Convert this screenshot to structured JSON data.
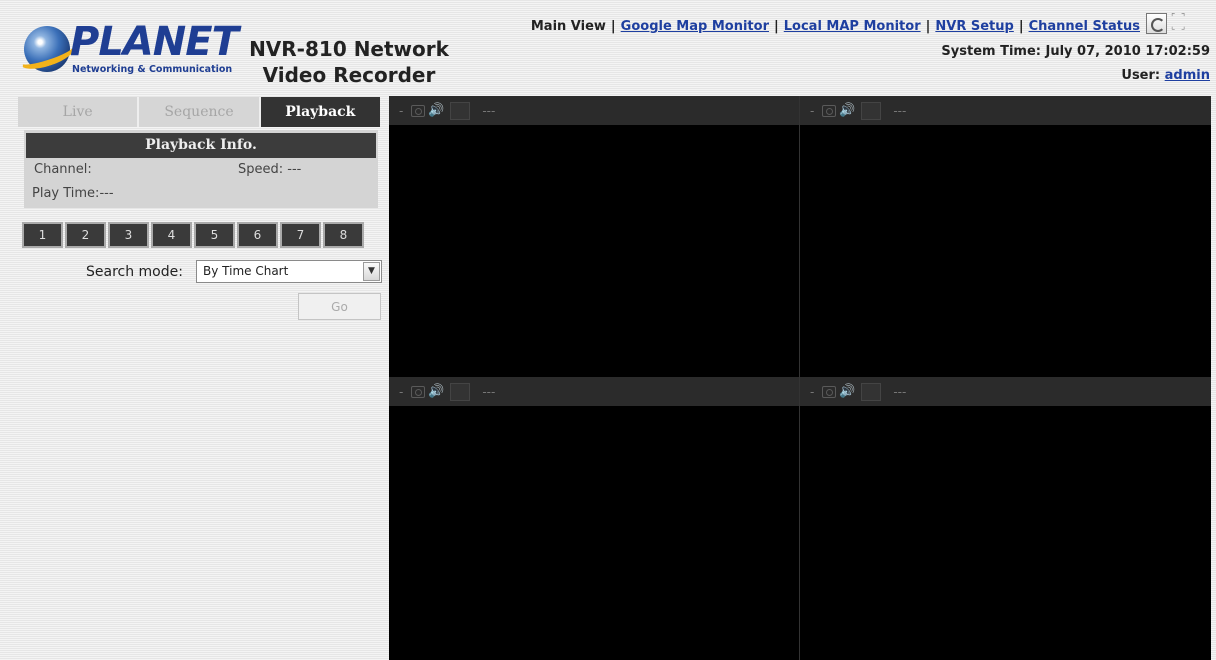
{
  "logo": {
    "text": "PLANET",
    "tagline": "Networking & Communication"
  },
  "product": {
    "line1": "NVR-810 Network",
    "line2": "Video Recorder"
  },
  "nav": {
    "main_view": "Main View",
    "google_map": "Google Map Monitor",
    "local_map": "Local MAP Monitor",
    "nvr_setup": "NVR Setup",
    "channel_status": "Channel Status",
    "separator": "|"
  },
  "system_time": "System Time: July 07, 2010 17:02:59",
  "user": {
    "label": "User:",
    "name": "admin"
  },
  "tabs": [
    {
      "label": "Live"
    },
    {
      "label": "Sequence"
    },
    {
      "label": "Playback"
    }
  ],
  "playback_info": {
    "header": "Playback Info.",
    "channel_label": "Channel:",
    "speed_label": "Speed: ---",
    "play_time": "Play Time:---"
  },
  "channels": [
    "1",
    "2",
    "3",
    "4",
    "5",
    "6",
    "7",
    "8"
  ],
  "search": {
    "label": "Search mode:",
    "selected": "By Time Chart",
    "go_label": "Go"
  },
  "video_cells": [
    {
      "dash": "-",
      "name": "---"
    },
    {
      "dash": "-",
      "name": "---"
    },
    {
      "dash": "-",
      "name": "---"
    },
    {
      "dash": "-",
      "name": "---"
    }
  ],
  "colors": {
    "link": "#1e3fa0",
    "logo": "#1f3e93",
    "active_tab": "#333333",
    "video_bg": "#000000"
  }
}
